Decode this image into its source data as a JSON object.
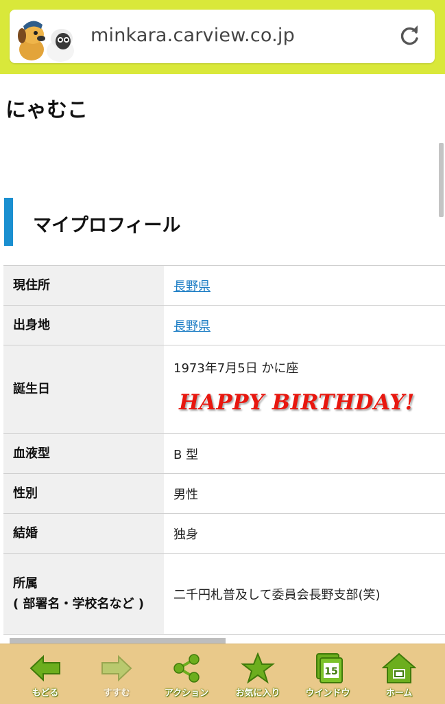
{
  "browser": {
    "url": "minkara.carview.co.jp"
  },
  "page": {
    "username": "にゃむこ",
    "section_title": "マイプロフィール"
  },
  "profile": {
    "rows": [
      {
        "key": "現住所",
        "value": "長野県"
      },
      {
        "key": "出身地",
        "value": "長野県"
      },
      {
        "key": "誕生日",
        "value": "1973年7月5日 かに座",
        "banner": "HAPPY BIRTHDAY!"
      },
      {
        "key": "血液型",
        "value": "B 型"
      },
      {
        "key": "性別",
        "value": "男性"
      },
      {
        "key": "結婚",
        "value": "独身"
      },
      {
        "key": "所属\n( 部署名・学校名など )",
        "value": "二千円札普及して委員会長野支部(笑)"
      }
    ]
  },
  "toolbar": {
    "back": "もどる",
    "forward": "すすむ",
    "action": "アクション",
    "favorite": "お気に入り",
    "window": "ウインドウ",
    "window_count": "15",
    "home": "ホーム"
  },
  "colors": {
    "topbar": "#d9e83a",
    "accent": "#1a8fd0",
    "toolbar": "#e9c98a",
    "icon_green": "#6cae1e"
  }
}
